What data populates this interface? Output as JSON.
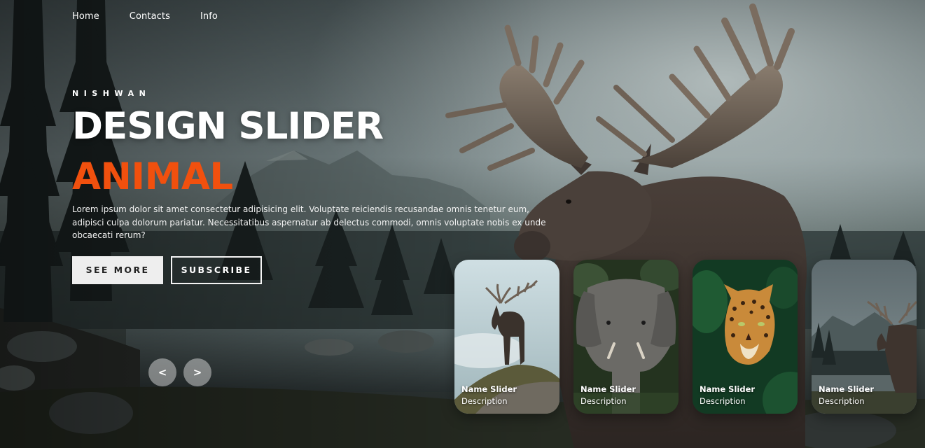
{
  "nav": {
    "items": [
      {
        "label": "Home"
      },
      {
        "label": "Contacts"
      },
      {
        "label": "Info"
      }
    ]
  },
  "hero": {
    "author": "NISHWAN",
    "title": "DESIGN SLIDER",
    "topic": "ANIMAL",
    "description": "Lorem ipsum dolor sit amet consectetur adipisicing elit. Voluptate reiciendis recusandae omnis tenetur eum, adipisci culpa dolorum pariatur. Necessitatibus aspernatur ab delectus commodi, omnis voluptate nobis ex unde obcaecati rerum?",
    "see_more_label": "SEE MORE",
    "subscribe_label": "SUBSCRIBE"
  },
  "controls": {
    "prev_label": "<",
    "next_label": ">"
  },
  "thumbnails": [
    {
      "name": "Name Slider",
      "description": "Description",
      "subject": "moose-icon"
    },
    {
      "name": "Name Slider",
      "description": "Description",
      "subject": "elephant-icon"
    },
    {
      "name": "Name Slider",
      "description": "Description",
      "subject": "leopard-icon"
    },
    {
      "name": "Name Slider",
      "description": "Description",
      "subject": "moose-icon"
    }
  ],
  "colors": {
    "accent": "#f1500e",
    "button_light": "#eeeeee",
    "sky": "#6f7d80",
    "forest": "#1d2526"
  }
}
